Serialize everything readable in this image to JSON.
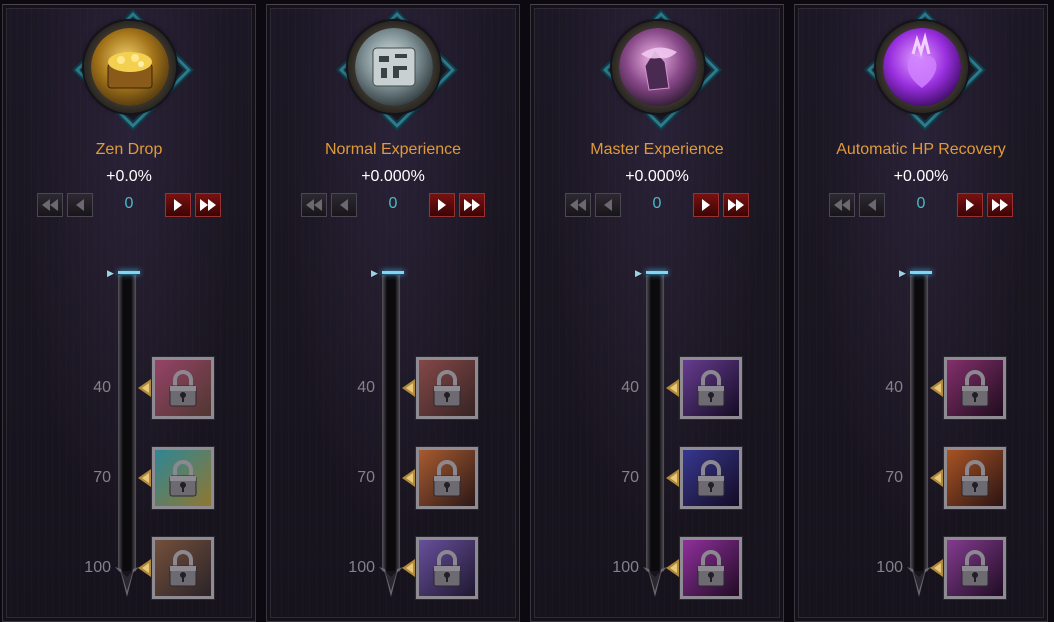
{
  "panels": [
    {
      "title": "Zen Drop",
      "value": "+0.0%",
      "count": "0",
      "orb_colors": [
        "#f0d06a",
        "#a27218",
        "#4a3410"
      ],
      "orb_icon": "treasure-chest-icon",
      "levels": [
        {
          "label": "40",
          "reward_icon": "locked-zen-reward-icon",
          "colors": [
            "#c85a8a",
            "#6a4a40"
          ]
        },
        {
          "label": "70",
          "reward_icon": "locked-zen-reward-icon",
          "colors": [
            "#3fb3c8",
            "#c0a040"
          ]
        },
        {
          "label": "100",
          "reward_icon": "locked-zen-reward-icon",
          "colors": [
            "#9a6a50",
            "#3a3036"
          ]
        }
      ]
    },
    {
      "title": "Normal Experience",
      "value": "+0.000%",
      "count": "0",
      "orb_colors": [
        "#d8e4e6",
        "#7a8c90",
        "#2a3438"
      ],
      "orb_icon": "rune-stone-icon",
      "levels": [
        {
          "label": "40",
          "reward_icon": "locked-experience-reward-icon",
          "colors": [
            "#b06060",
            "#4a3030"
          ]
        },
        {
          "label": "70",
          "reward_icon": "locked-experience-reward-icon",
          "colors": [
            "#e07a40",
            "#3a2020"
          ]
        },
        {
          "label": "100",
          "reward_icon": "locked-experience-reward-icon",
          "colors": [
            "#8a6ad0",
            "#2a2040"
          ]
        }
      ]
    },
    {
      "title": "Master Experience",
      "value": "+0.000%",
      "count": "0",
      "orb_colors": [
        "#f2b8e8",
        "#8a4a8a",
        "#2a1830"
      ],
      "orb_icon": "crystal-icon",
      "levels": [
        {
          "label": "40",
          "reward_icon": "locked-master-reward-icon",
          "colors": [
            "#8a50c0",
            "#1a1030"
          ]
        },
        {
          "label": "70",
          "reward_icon": "locked-master-reward-icon",
          "colors": [
            "#4a4ac0",
            "#1a1030"
          ]
        },
        {
          "label": "100",
          "reward_icon": "locked-master-reward-icon",
          "colors": [
            "#c040d0",
            "#2a1030"
          ]
        }
      ]
    },
    {
      "title": "Automatic HP Recovery",
      "value": "+0.00%",
      "count": "0",
      "orb_colors": [
        "#e2a0ff",
        "#9a30e0",
        "#3a0a60"
      ],
      "orb_icon": "heart-flame-icon",
      "levels": [
        {
          "label": "40",
          "reward_icon": "locked-hp-reward-icon",
          "colors": [
            "#b04090",
            "#2a1028"
          ]
        },
        {
          "label": "70",
          "reward_icon": "locked-hp-reward-icon",
          "colors": [
            "#e07030",
            "#3a1a1a"
          ]
        },
        {
          "label": "100",
          "reward_icon": "locked-hp-reward-icon",
          "colors": [
            "#b050c0",
            "#2a1030"
          ]
        }
      ]
    }
  ],
  "controls": {
    "first_icon": "double-left-icon",
    "prev_icon": "left-icon",
    "next_icon": "right-icon",
    "last_icon": "double-right-icon"
  },
  "colors": {
    "title": "#e09a3a",
    "value": "#ffffff",
    "count": "#4dbac6",
    "level_label": "#858189",
    "teal_frame": "#2e7a8c",
    "red_button": "#7a1111"
  }
}
